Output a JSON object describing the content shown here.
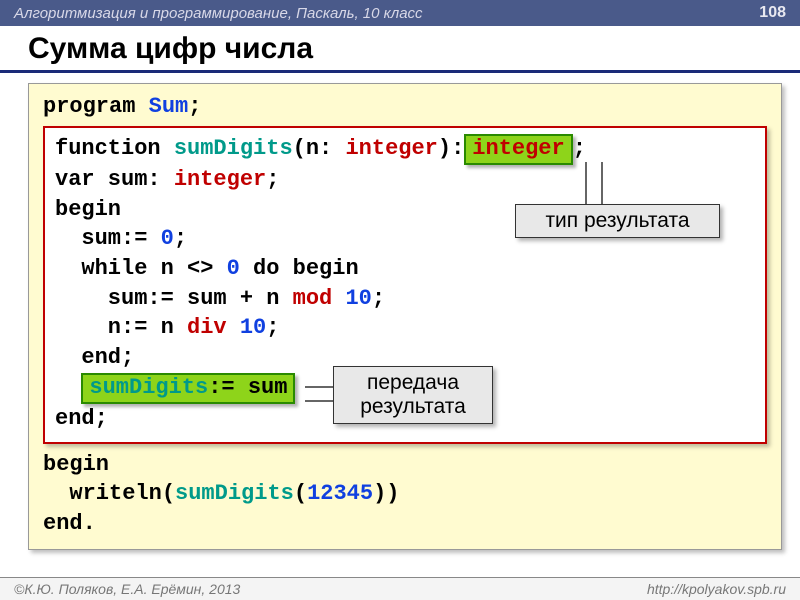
{
  "header": {
    "course": "Алгоритмизация и программирование, Паскаль, 10 класс",
    "page": "108"
  },
  "title": "Сумма цифр числа",
  "code": {
    "l1_program": "program ",
    "l1_name": "Sum",
    "l1_semi": ";",
    "f1_kw": "function ",
    "f1_name": "sumDigits",
    "f1_open": "(n: ",
    "f1_type1": "integer",
    "f1_close": "):",
    "f1_ret": "integer",
    "f1_semi": ";",
    "f2_a": "var sum: ",
    "f2_type": "integer",
    "f2_semi": ";",
    "f3": "begin",
    "f4_a": "  sum:= ",
    "f4_zero": "0",
    "f4_semi": ";",
    "f5_a": "  while n <> ",
    "f5_zero": "0",
    "f5_b": " do begin",
    "f6_a": "    sum:= sum + n ",
    "f6_mod": "mod",
    "f6_sp": " ",
    "f6_ten": "10",
    "f6_semi": ";",
    "f7_a": "    n:= n ",
    "f7_div": "div",
    "f7_sp": " ",
    "f7_ten": "10",
    "f7_semi": ";",
    "f8": "  end;",
    "f9_name": "sumDigits",
    "f9_rest": ":= sum",
    "f10": "end;",
    "m1": "begin",
    "m2_a": "  writeln(",
    "m2_name": "sumDigits",
    "m2_open": "(",
    "m2_arg": "12345",
    "m2_close": "))",
    "m3": "end."
  },
  "callouts": {
    "ret_type": "тип результата",
    "pass_result_l1": "передача",
    "pass_result_l2": "результата"
  },
  "footer": {
    "authors": "К.Ю. Поляков, Е.А. Ерёмин, 2013",
    "url": "http://kpolyakov.spb.ru"
  }
}
